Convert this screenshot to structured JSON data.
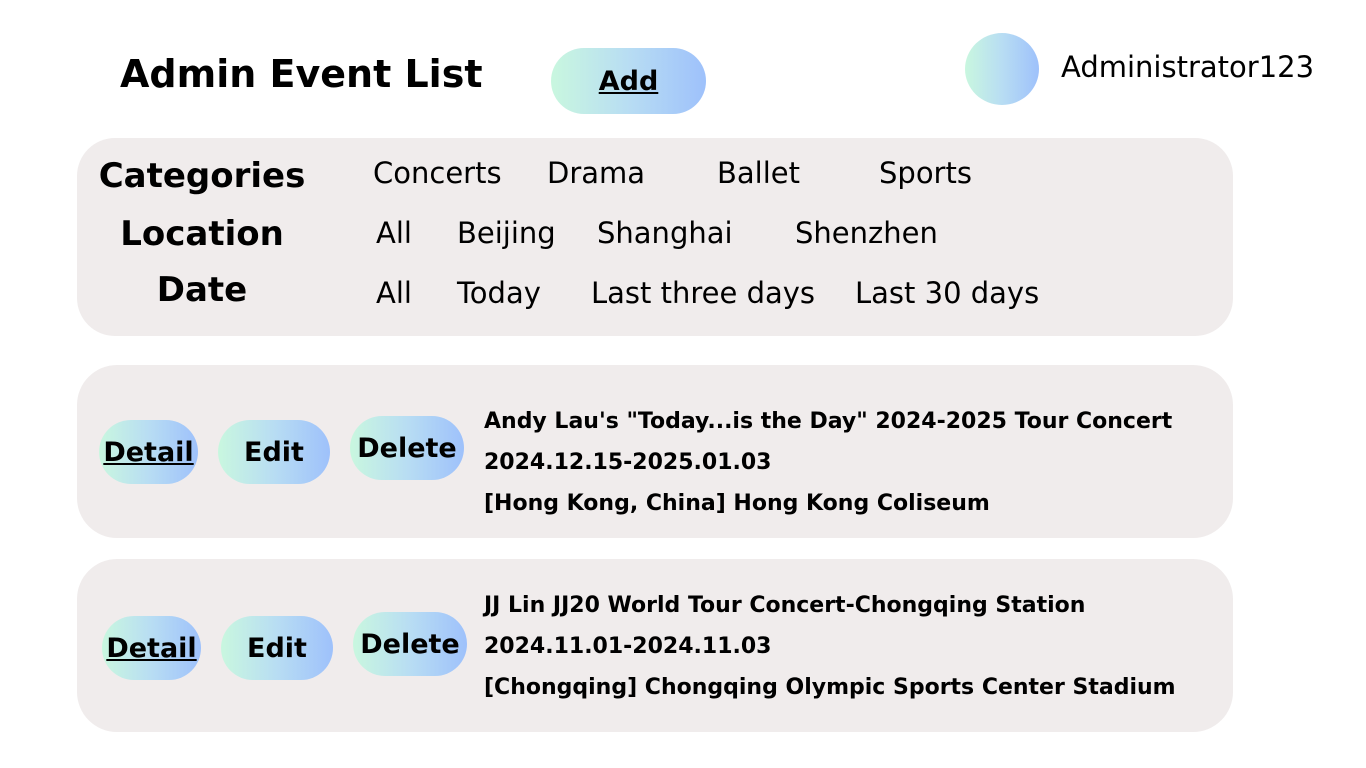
{
  "header": {
    "title": "Admin Event List",
    "add_label": "Add",
    "username": "Administrator123"
  },
  "filters": {
    "categories": {
      "label": "Categories",
      "options": [
        "Concerts",
        "Drama",
        "Ballet",
        "Sports"
      ]
    },
    "location": {
      "label": "Location",
      "options": [
        "All",
        "Beijing",
        "Shanghai",
        "Shenzhen"
      ]
    },
    "date": {
      "label": "Date",
      "options": [
        "All",
        "Today",
        "Last three days",
        "Last 30 days"
      ]
    }
  },
  "events": [
    {
      "detail_label": "Detail",
      "edit_label": "Edit",
      "delete_label": "Delete",
      "title": "Andy Lau's \"Today...is the Day\" 2024-2025 Tour Concert",
      "dates": "2024.12.15-2025.01.03",
      "venue": "[Hong Kong, China] Hong Kong Coliseum"
    },
    {
      "detail_label": "Detail",
      "edit_label": "Edit",
      "delete_label": "Delete",
      "title": "JJ Lin JJ20 World Tour Concert-Chongqing Station",
      "dates": "2024.11.01-2024.11.03",
      "venue": "[Chongqing] Chongqing Olympic Sports Center Stadium"
    }
  ],
  "colors": {
    "gradient_start": "#c9f7df",
    "gradient_end": "#9ec1fb",
    "panel_bg": "#f0ecec"
  }
}
